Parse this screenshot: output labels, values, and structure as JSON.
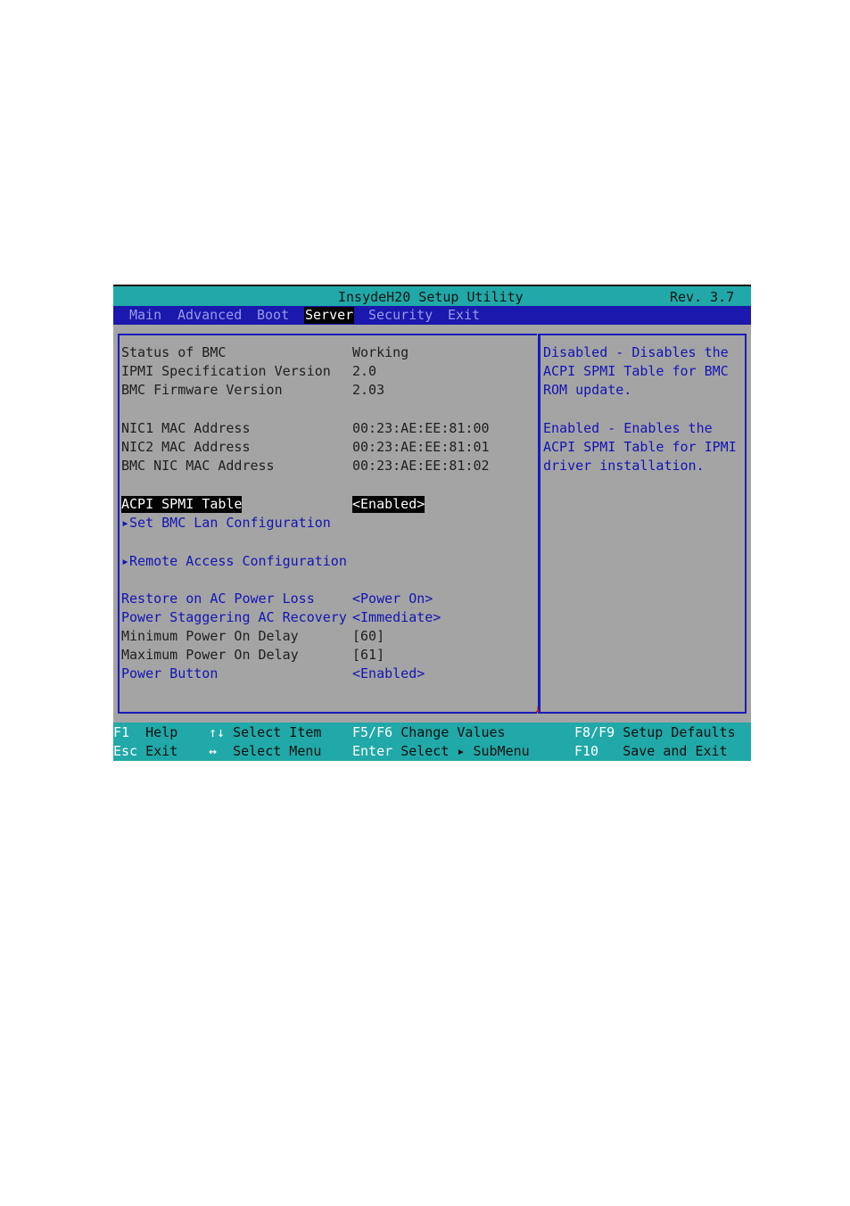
{
  "title": "InsydeH20 Setup Utility",
  "revision": "Rev. 3.7",
  "tabs": [
    "Main",
    "Advanced",
    "Boot",
    "Server",
    "Security",
    "Exit"
  ],
  "active_tab": "Server",
  "rows": {
    "status_bmc": {
      "label": "Status of BMC",
      "value": "Working"
    },
    "ipmi_spec": {
      "label": "IPMI Specification Version",
      "value": "2.0"
    },
    "bmc_fw": {
      "label": "BMC Firmware Version",
      "value": "2.03"
    },
    "nic1": {
      "label": "NIC1 MAC Address",
      "value": "00:23:AE:EE:81:00"
    },
    "nic2": {
      "label": "NIC2 MAC Address",
      "value": "00:23:AE:EE:81:01"
    },
    "bmc_nic": {
      "label": "BMC NIC MAC Address",
      "value": "00:23:AE:EE:81:02"
    },
    "acpi_spmi": {
      "label": "ACPI SPMI Table",
      "value": "<Enabled>"
    },
    "set_bmc_lan": {
      "label": "Set BMC Lan Configuration"
    },
    "remote_access": {
      "label": "Remote Access Configuration"
    },
    "restore_ac": {
      "label": "Restore on AC Power Loss",
      "value": "<Power On>"
    },
    "power_stagger": {
      "label": "Power Staggering AC Recovery",
      "value": "<Immediate>"
    },
    "min_delay": {
      "label": "Minimum Power On Delay",
      "value": "[60]"
    },
    "max_delay": {
      "label": "Maximum Power On Delay",
      "value": "[61]"
    },
    "power_button": {
      "label": "Power Button",
      "value": "<Enabled>"
    }
  },
  "help_lines": [
    "Disabled - Disables the",
    "ACPI SPMI Table for BMC",
    "ROM update.",
    "",
    "Enabled - Enables the",
    "ACPI SPMI Table for IPMI",
    "driver installation."
  ],
  "footer": {
    "f1_key": "F1",
    "f1_desc": "Help",
    "esc_key": "Esc",
    "esc_desc": "Exit",
    "updown_key": "↑↓",
    "updown_desc": "Select Item",
    "leftright_key": "↔",
    "leftright_desc": "Select Menu",
    "f5f6_key": "F5/F6",
    "f5f6_desc": "Change Values",
    "enter_key": "Enter",
    "enter_desc": "Select ▸ SubMenu",
    "f8f9_key": "F8/F9",
    "f8f9_desc": "Setup Defaults",
    "f10_key": "F10",
    "f10_desc": "Save and Exit"
  },
  "colors": {
    "background": "#a4a4a4",
    "title_bar": "#21a8a8",
    "menu_bar": "#1a18ad",
    "accent_text": "#1414b4",
    "scroll_arrow": "#d41010"
  }
}
